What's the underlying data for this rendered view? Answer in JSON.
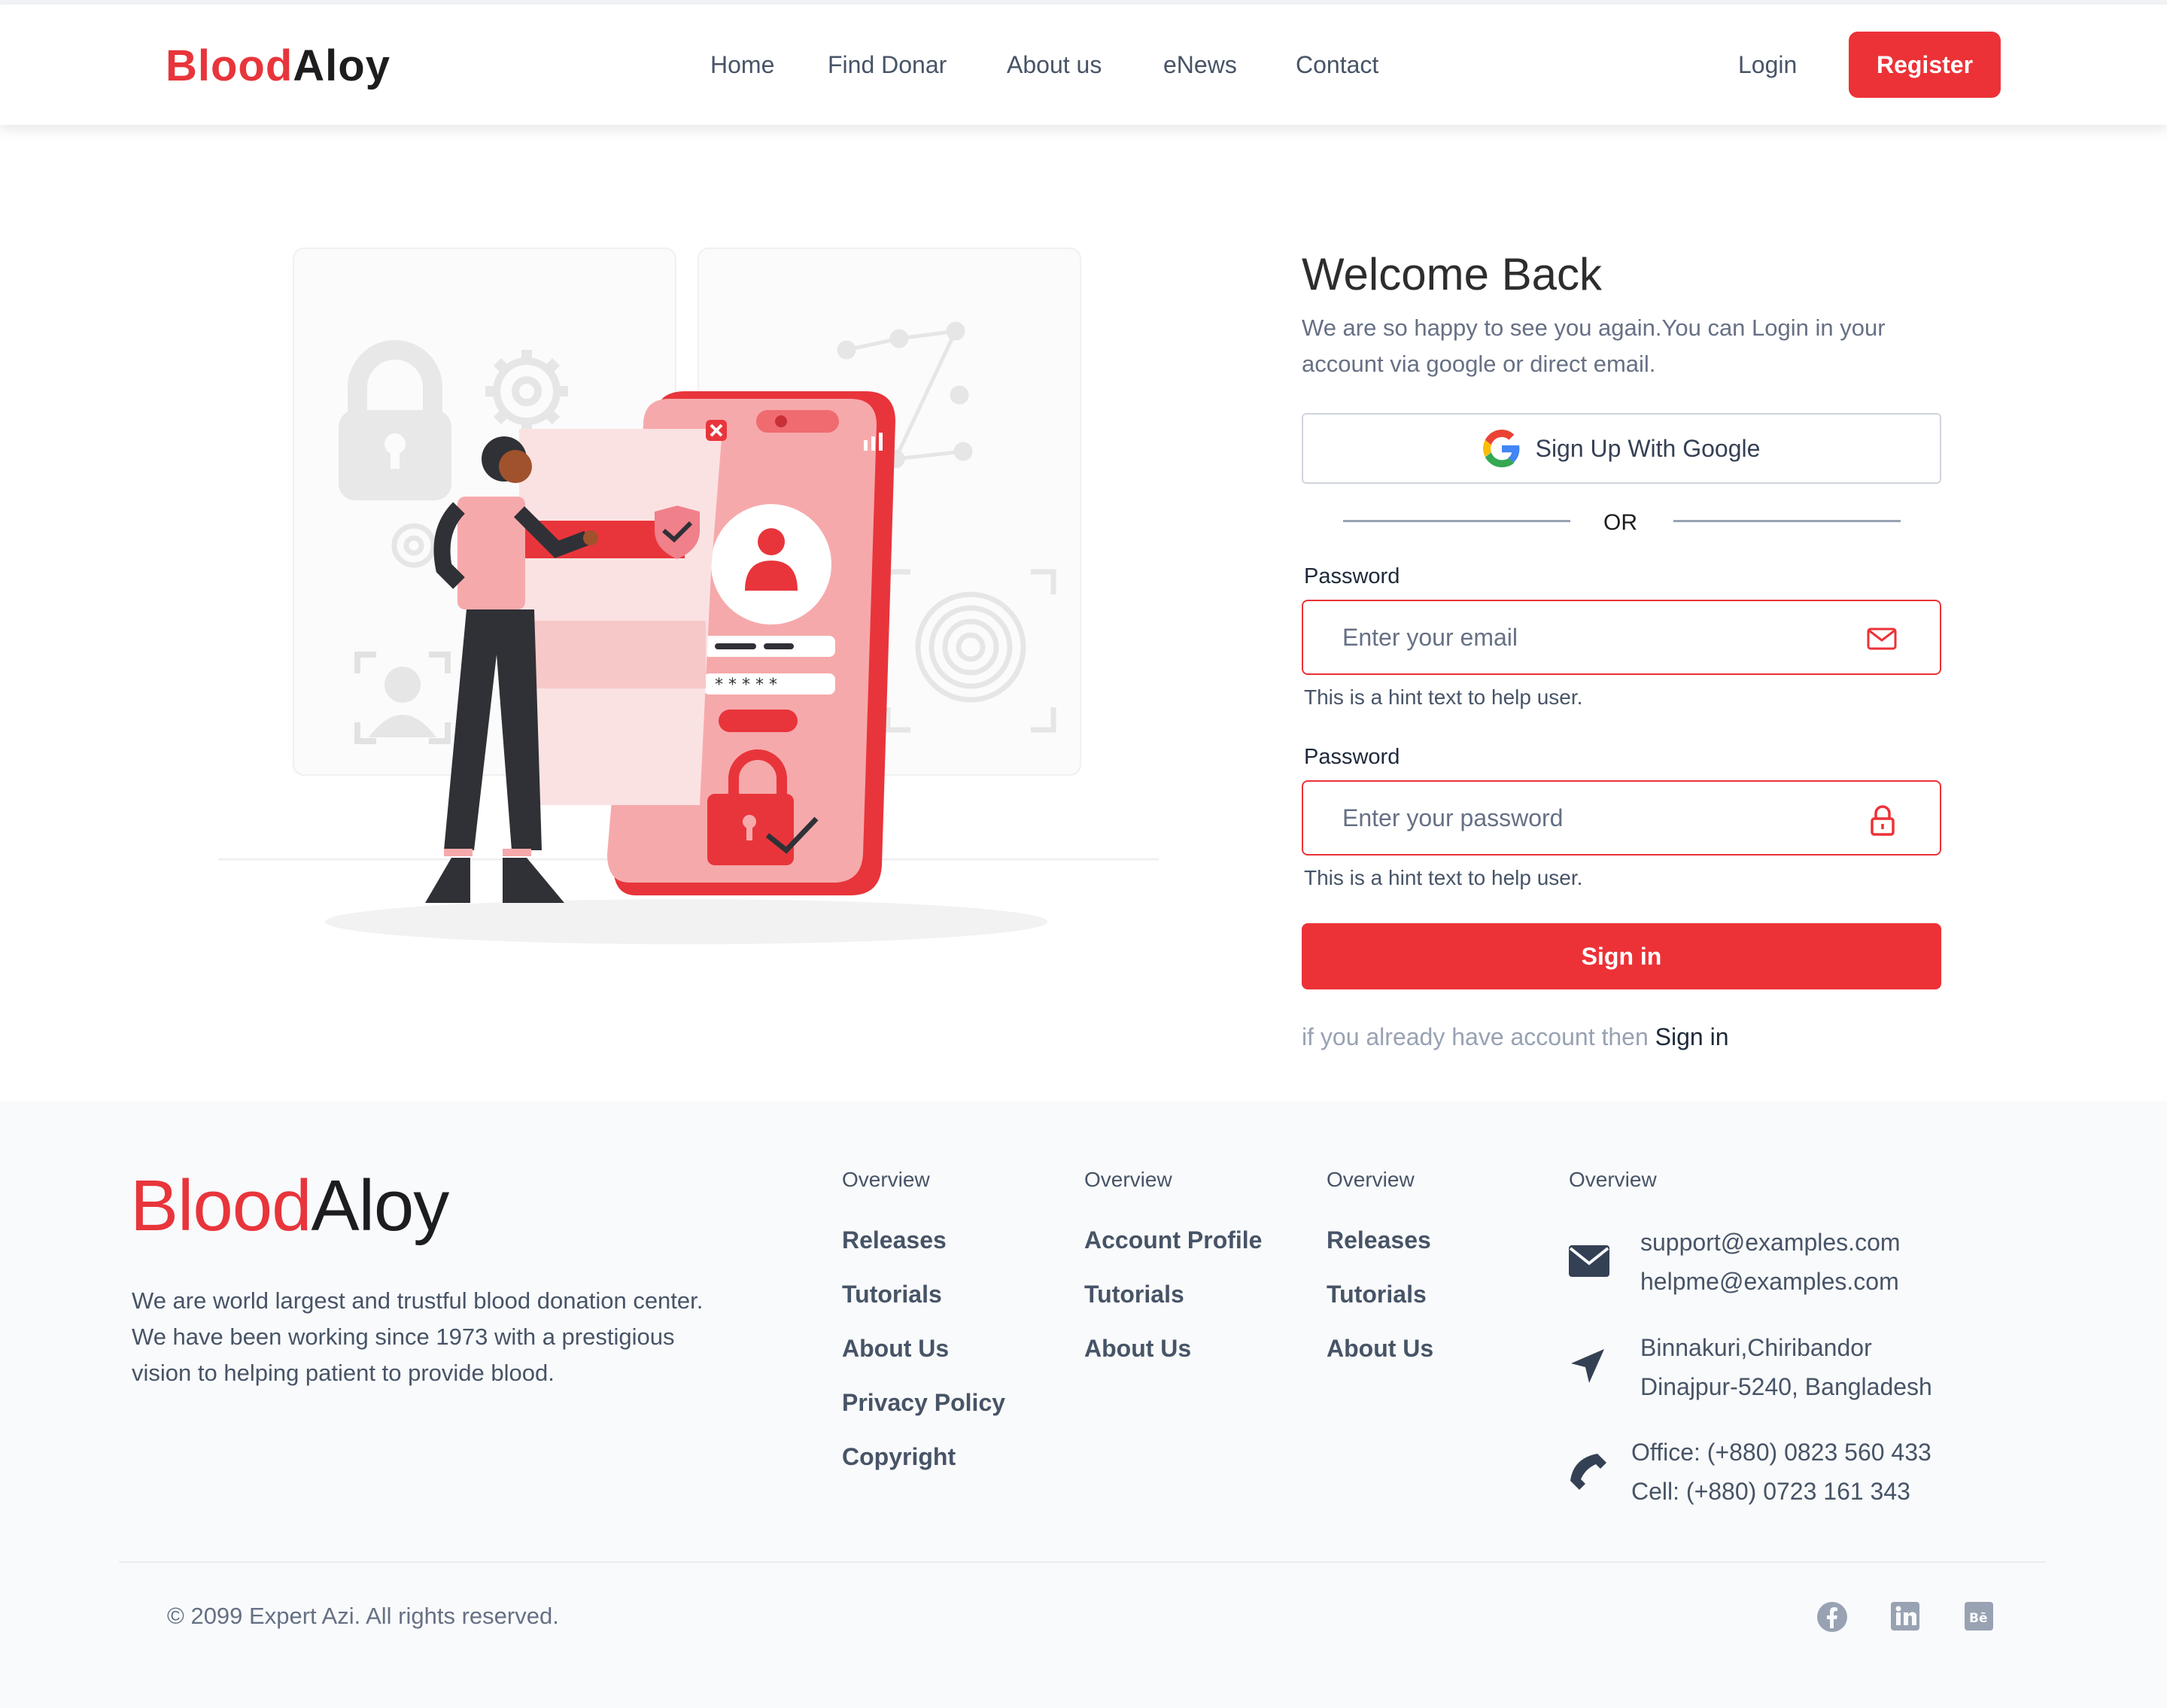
{
  "header": {
    "logo_part1": "Blood",
    "logo_part2": "Aloy",
    "nav": [
      "Home",
      "Find Donar",
      "About us",
      "eNews",
      "Contact"
    ],
    "login": "Login",
    "register": "Register"
  },
  "login_form": {
    "title": "Welcome Back",
    "subtitle": "We are so happy to see you again.You can Login in your account via google or direct email.",
    "google_button": "Sign Up With Google",
    "divider_text": "OR",
    "email_label": "Password",
    "email_placeholder": "Enter your email",
    "email_hint": "This is a hint text to help user.",
    "password_label": "Password",
    "password_placeholder": "Enter your password",
    "password_hint": "This is a hint text to help user.",
    "submit": "Sign in",
    "already_text": "if you already have account then",
    "already_link": "Sign in"
  },
  "footer": {
    "logo_part1": "Blood",
    "logo_part2": "Aloy",
    "about": "We are world largest and trustful blood donation center. We have been working since 1973 with a prestigious vision to helping patient to provide blood.",
    "columns": [
      {
        "heading": "Overview",
        "links": [
          "Releases",
          "Tutorials",
          "About Us",
          "Privacy Policy",
          "Copyright"
        ]
      },
      {
        "heading": "Overview",
        "links": [
          "Account Profile",
          "Tutorials",
          "About Us"
        ]
      },
      {
        "heading": "Overview",
        "links": [
          "Releases",
          "Tutorials",
          "About Us"
        ]
      }
    ],
    "contact": {
      "heading": "Overview",
      "email_1": "support@examples.com",
      "email_2": "helpme@examples.com",
      "address_1": "Binnakuri,Chiribandor",
      "address_2": "Dinajpur-5240, Bangladesh",
      "office_phone": "Office: (+880) 0823 560 433",
      "cell_phone": "Cell: (+880) 0723 161 343"
    },
    "copyright": "© 2099 Expert Azi. All rights reserved.",
    "social_icons": [
      "facebook-icon",
      "linkedin-icon",
      "behance-icon"
    ]
  },
  "colors": {
    "brand_red": "#ec3237",
    "text_gray": "#475467",
    "footer_bg": "#f9fafb"
  }
}
